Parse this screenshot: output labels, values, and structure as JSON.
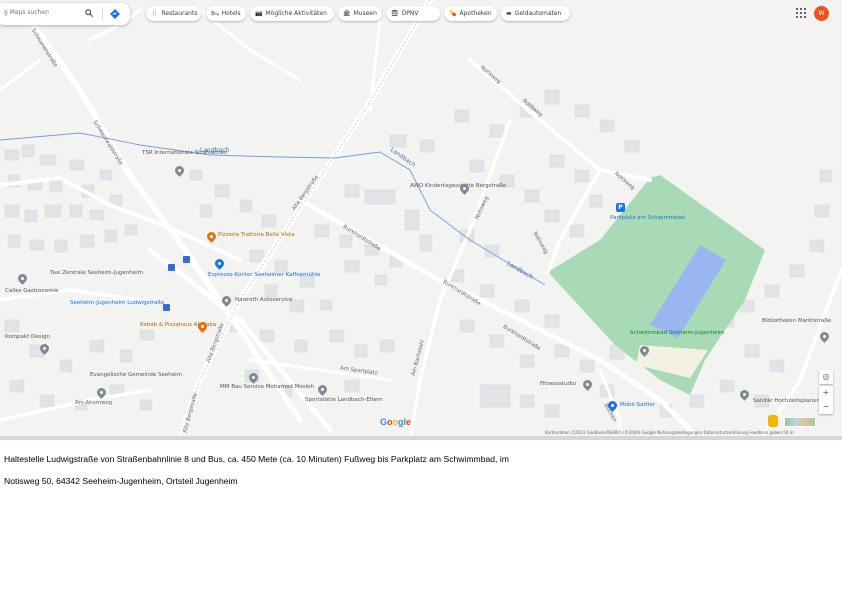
{
  "search": {
    "placeholder": "g Maps suchen"
  },
  "chips": [
    {
      "icon": "🍴",
      "label": "Restaurants"
    },
    {
      "icon": "🛏",
      "label": "Hotels"
    },
    {
      "icon": "📷",
      "label": "Mögliche Aktivitäten"
    },
    {
      "icon": "🏛",
      "label": "Museen"
    },
    {
      "icon": "🚍",
      "label": "ÖPNV"
    },
    {
      "icon": "💊",
      "label": "Apotheken"
    },
    {
      "icon": "▬",
      "label": "Geldautomaten"
    }
  ],
  "user": {
    "initials": "W",
    "color": "#e8541c"
  },
  "map_labels": {
    "landbach_1": "Landbach",
    "landbach_2": "Landbach",
    "landbach_3": "Landbach",
    "schwanenstrasse": "Schwanenstraße",
    "schwarzwaldstrasse": "Schwarzwaldstraße",
    "alte_bergstrasse_1": "Alte Bergstraße",
    "alte_bergstrasse_2": "Alte Bergstraße",
    "alte_bergstrasse_3": "Alte Bergstraße",
    "burkhardtstrasse_1": "Burkhardtstraße",
    "burkhardtstrasse_2": "Burkhardtstraße",
    "burkhardtstrasse_3": "Burkhardtstraße",
    "notisweg_1": "Notisweg",
    "notisweg_2": "Notisweg",
    "notisweg_3": "Notisweg",
    "notisweg_4": "Notisweg",
    "notisweg_5": "Notisweg",
    "am_bachstahl": "Am Bachstahl",
    "am_sportplatz": "Am Sportplatz",
    "buchenweg": "Buchen",
    "tsr": "TSR Internationale Strafsachen",
    "awo": "AWO Kindertagesstätte Bergstraße",
    "pizzeria": "Pizzeria Trattoria Bella Vista",
    "espresso": "Espresso-Kontor Seeheimer Kaffeemühle",
    "taxi": "Taxi Zentrale Seeheim-Jugenheim",
    "bahnhof": "Seeheim-Jugenheim Ludwigstraße",
    "kebab": "Kebab & Pizzahaus Ali Baba",
    "nawroth": "Nawroth Autoservice",
    "kompakt": "Kompakt Design",
    "ev_gemeinde": "Evangelische Gemeinde Seeheim",
    "mm_bau": "MM Bau Service Mohamed Mosleh",
    "sportstaette": "Sportstätte Landbach-Eltern",
    "parkplatz": "Parkplatz am Schwimmbad",
    "schwimmbad": "Schwimmbad Seeheim-Jugenheim",
    "hasenkeller": "Fitnessstudio",
    "mobil": "Mobil-Sattler",
    "bibliothek": "Bibliotheken Marktstraße",
    "sanitaer": "Sanitär Hochzeitsplanung",
    "calles": "Calles Gastronomie",
    "ahnenweg": "Am Ahornweg"
  },
  "footer": {
    "google_parts": [
      "G",
      "o",
      "o",
      "g",
      "l",
      "e"
    ],
    "attribution": "Kartendaten ©2023 GeoBasis-DE/BKG (©2009)   Google   Nutzungsbedingungen   Datenschutzerklärung   Feedback geben   50 m"
  },
  "caption": {
    "line1": "Haltestelle Ludwigstraße von Straßenbahnlinie 8 und Bus, ca. 450 Mete (ca. 10 Minuten) Fußweg bis Parkplatz am Schwimmbad, im",
    "line2": "Notisweg 50, 64342 Seeheim-Jugenheim, Ortsteil Jugenheim"
  },
  "colors": {
    "park": "#a8dab5",
    "water": "#9ab6f1",
    "road": "#ffffff",
    "building": "#e3e4e6"
  }
}
